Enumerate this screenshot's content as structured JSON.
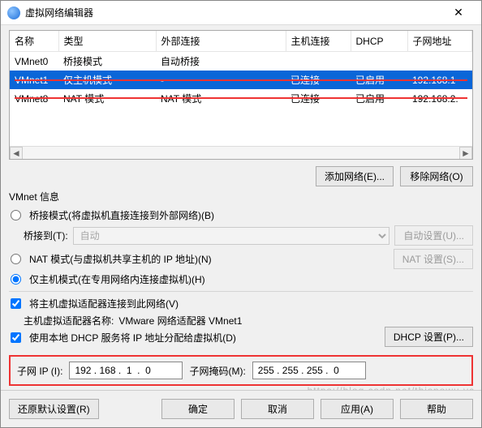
{
  "window": {
    "title": "虚拟网络编辑器",
    "close": "✕"
  },
  "columns": {
    "name": "名称",
    "type": "类型",
    "ext": "外部连接",
    "host": "主机连接",
    "dhcp": "DHCP",
    "subnet": "子网地址"
  },
  "rows": [
    {
      "name": "VMnet0",
      "type": "桥接模式",
      "ext": "自动桥接",
      "host": "",
      "dhcp": "",
      "subnet": ""
    },
    {
      "name": "VMnet1",
      "type": "仅主机模式",
      "ext": "-",
      "host": "已连接",
      "dhcp": "已启用",
      "subnet": "192.168.1"
    },
    {
      "name": "VMnet8",
      "type": "NAT 模式",
      "ext": "NAT 模式",
      "host": "已连接",
      "dhcp": "已启用",
      "subnet": "192.168.2."
    }
  ],
  "buttons": {
    "add": "添加网络(E)...",
    "remove": "移除网络(O)"
  },
  "group": "VMnet 信息",
  "opt_bridge": "桥接模式(将虚拟机直接连接到外部网络)(B)",
  "bridge_to_label": "桥接到(T):",
  "bridge_auto": "自动",
  "auto_settings": "自动设置(U)...",
  "opt_nat": "NAT 模式(与虚拟机共享主机的 IP 地址)(N)",
  "nat_settings": "NAT 设置(S)...",
  "opt_host": "仅主机模式(在专用网络内连接虚拟机)(H)",
  "chk_adapter": "将主机虚拟适配器连接到此网络(V)",
  "adapter_name_label": "主机虚拟适配器名称: ",
  "adapter_name": "VMware 网络适配器 VMnet1",
  "chk_dhcp": "使用本地 DHCP 服务将 IP 地址分配给虚拟机(D)",
  "dhcp_settings": "DHCP 设置(P)...",
  "subnet_ip_label": "子网 IP (I):",
  "subnet_ip": "192 . 168 .  1  .  0",
  "subnet_mask_label": "子网掩码(M):",
  "subnet_mask": "255 . 255 . 255 .  0",
  "footer": {
    "restore": "还原默认设置(R)",
    "ok": "确定",
    "cancel": "取消",
    "apply": "应用(A)",
    "help": "帮助"
  },
  "watermark": "https://blog.csdn.net/thisnowu.vc"
}
